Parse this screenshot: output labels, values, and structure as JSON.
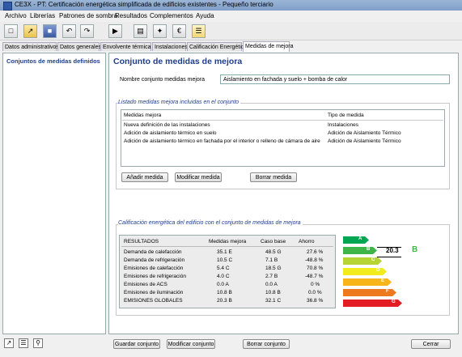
{
  "window": {
    "title": "CE3X - PT: Certificación energética simplificada de edificios existentes - Pequeño terciario"
  },
  "menu": [
    "Archivo",
    "Librerías",
    "Patrones de sombra",
    "Resultados",
    "Complementos",
    "Ayuda"
  ],
  "toolbar_icons": [
    "new-file-icon",
    "open-folder-icon",
    "save-icon",
    "undo-icon",
    "redo-icon",
    "import-icon",
    "building-icon",
    "magic-wand-icon",
    "euro-icon",
    "report-icon"
  ],
  "tabs": [
    "Datos administrativos",
    "Datos generales",
    "Envolvente térmica",
    "Instalaciones",
    "Calificación Energética",
    "Medidas de mejora"
  ],
  "sidebar": {
    "item": "Conjuntos de medidas definidos"
  },
  "main": {
    "title": "Conjunto de medidas de mejora",
    "name_label": "Nombre conjunto medidas mejora",
    "name_value": "Aislamiento en fachada y suelo + bomba de calor"
  },
  "measures": {
    "group_title": "Listado medidas mejora incluidas en el conjunto",
    "col_measure": "Medidas mejora",
    "col_type": "Tipo de medida",
    "rows": [
      {
        "measure": "Nueva definición de las instalaciones",
        "type": "Instalaciones"
      },
      {
        "measure": "Adición de aislamiento térmico en suelo",
        "type": "Adición de Aislamiento Térmico"
      },
      {
        "measure": "Adición de aislamiento térmico en fachada por el interior o relleno de cámara de aire",
        "type": "Adición de Aislamiento Térmico"
      }
    ],
    "add_label": "Añadir medida",
    "modify_label": "Modificar medida",
    "delete_label": "Borrar medida"
  },
  "rating": {
    "group_title": "Calificación energética del edificio con el conjunto de medidas de mejora",
    "headers": [
      "RESULTADOS",
      "Medidas mejora",
      "Caso base",
      "Ahorro"
    ],
    "rows": [
      [
        "Demanda de calefacción",
        "35.1 E",
        "48.5 G",
        "27.6 %"
      ],
      [
        "Demanda de refrigeración",
        "10.5 C",
        "7.1 B",
        "-48.8 %"
      ],
      [
        "Emisiones de calefacción",
        "5.4 C",
        "18.5 G",
        "70.8 %"
      ],
      [
        "Emisiones de refrigeración",
        "4.0 C",
        "2.7 B",
        "-48.7 %"
      ],
      [
        "Emisiones de ACS",
        "0.0 A",
        "0.0 A",
        "0 %"
      ],
      [
        "Emisiones de iluminación",
        "10.8 B",
        "10.8 B",
        "0.0 %"
      ],
      [
        "EMISIONES GLOBALES",
        "20.3 B",
        "32.1 C",
        "36.8 %"
      ]
    ],
    "scale": [
      {
        "letter": "A",
        "color": "#00a651"
      },
      {
        "letter": "B",
        "color": "#3fb549"
      },
      {
        "letter": "C",
        "color": "#b6d433"
      },
      {
        "letter": "D",
        "color": "#f2ec1c"
      },
      {
        "letter": "E",
        "color": "#f7b519"
      },
      {
        "letter": "F",
        "color": "#ee7a1f"
      },
      {
        "letter": "G",
        "color": "#e31d24"
      }
    ],
    "result_value": "20.3",
    "result_letter": "B",
    "result_letter_color": "#3fb549"
  },
  "footer": {
    "save_label": "Guardar conjunto",
    "modify_label": "Modificar conjunto",
    "delete_label": "Borrar conjunto",
    "close_label": "Cerrar",
    "icons": [
      "wand-icon",
      "list-icon",
      "key-icon"
    ]
  }
}
